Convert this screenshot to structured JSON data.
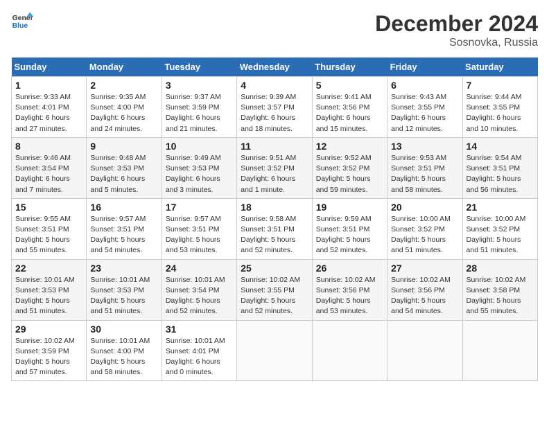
{
  "header": {
    "logo_line1": "General",
    "logo_line2": "Blue",
    "title": "December 2024",
    "subtitle": "Sosnovka, Russia"
  },
  "columns": [
    "Sunday",
    "Monday",
    "Tuesday",
    "Wednesday",
    "Thursday",
    "Friday",
    "Saturday"
  ],
  "weeks": [
    [
      {
        "day": "1",
        "lines": [
          "Sunrise: 9:33 AM",
          "Sunset: 4:01 PM",
          "Daylight: 6 hours",
          "and 27 minutes."
        ]
      },
      {
        "day": "2",
        "lines": [
          "Sunrise: 9:35 AM",
          "Sunset: 4:00 PM",
          "Daylight: 6 hours",
          "and 24 minutes."
        ]
      },
      {
        "day": "3",
        "lines": [
          "Sunrise: 9:37 AM",
          "Sunset: 3:59 PM",
          "Daylight: 6 hours",
          "and 21 minutes."
        ]
      },
      {
        "day": "4",
        "lines": [
          "Sunrise: 9:39 AM",
          "Sunset: 3:57 PM",
          "Daylight: 6 hours",
          "and 18 minutes."
        ]
      },
      {
        "day": "5",
        "lines": [
          "Sunrise: 9:41 AM",
          "Sunset: 3:56 PM",
          "Daylight: 6 hours",
          "and 15 minutes."
        ]
      },
      {
        "day": "6",
        "lines": [
          "Sunrise: 9:43 AM",
          "Sunset: 3:55 PM",
          "Daylight: 6 hours",
          "and 12 minutes."
        ]
      },
      {
        "day": "7",
        "lines": [
          "Sunrise: 9:44 AM",
          "Sunset: 3:55 PM",
          "Daylight: 6 hours",
          "and 10 minutes."
        ]
      }
    ],
    [
      {
        "day": "8",
        "lines": [
          "Sunrise: 9:46 AM",
          "Sunset: 3:54 PM",
          "Daylight: 6 hours",
          "and 7 minutes."
        ]
      },
      {
        "day": "9",
        "lines": [
          "Sunrise: 9:48 AM",
          "Sunset: 3:53 PM",
          "Daylight: 6 hours",
          "and 5 minutes."
        ]
      },
      {
        "day": "10",
        "lines": [
          "Sunrise: 9:49 AM",
          "Sunset: 3:53 PM",
          "Daylight: 6 hours",
          "and 3 minutes."
        ]
      },
      {
        "day": "11",
        "lines": [
          "Sunrise: 9:51 AM",
          "Sunset: 3:52 PM",
          "Daylight: 6 hours",
          "and 1 minute."
        ]
      },
      {
        "day": "12",
        "lines": [
          "Sunrise: 9:52 AM",
          "Sunset: 3:52 PM",
          "Daylight: 5 hours",
          "and 59 minutes."
        ]
      },
      {
        "day": "13",
        "lines": [
          "Sunrise: 9:53 AM",
          "Sunset: 3:51 PM",
          "Daylight: 5 hours",
          "and 58 minutes."
        ]
      },
      {
        "day": "14",
        "lines": [
          "Sunrise: 9:54 AM",
          "Sunset: 3:51 PM",
          "Daylight: 5 hours",
          "and 56 minutes."
        ]
      }
    ],
    [
      {
        "day": "15",
        "lines": [
          "Sunrise: 9:55 AM",
          "Sunset: 3:51 PM",
          "Daylight: 5 hours",
          "and 55 minutes."
        ]
      },
      {
        "day": "16",
        "lines": [
          "Sunrise: 9:57 AM",
          "Sunset: 3:51 PM",
          "Daylight: 5 hours",
          "and 54 minutes."
        ]
      },
      {
        "day": "17",
        "lines": [
          "Sunrise: 9:57 AM",
          "Sunset: 3:51 PM",
          "Daylight: 5 hours",
          "and 53 minutes."
        ]
      },
      {
        "day": "18",
        "lines": [
          "Sunrise: 9:58 AM",
          "Sunset: 3:51 PM",
          "Daylight: 5 hours",
          "and 52 minutes."
        ]
      },
      {
        "day": "19",
        "lines": [
          "Sunrise: 9:59 AM",
          "Sunset: 3:51 PM",
          "Daylight: 5 hours",
          "and 52 minutes."
        ]
      },
      {
        "day": "20",
        "lines": [
          "Sunrise: 10:00 AM",
          "Sunset: 3:52 PM",
          "Daylight: 5 hours",
          "and 51 minutes."
        ]
      },
      {
        "day": "21",
        "lines": [
          "Sunrise: 10:00 AM",
          "Sunset: 3:52 PM",
          "Daylight: 5 hours",
          "and 51 minutes."
        ]
      }
    ],
    [
      {
        "day": "22",
        "lines": [
          "Sunrise: 10:01 AM",
          "Sunset: 3:53 PM",
          "Daylight: 5 hours",
          "and 51 minutes."
        ]
      },
      {
        "day": "23",
        "lines": [
          "Sunrise: 10:01 AM",
          "Sunset: 3:53 PM",
          "Daylight: 5 hours",
          "and 51 minutes."
        ]
      },
      {
        "day": "24",
        "lines": [
          "Sunrise: 10:01 AM",
          "Sunset: 3:54 PM",
          "Daylight: 5 hours",
          "and 52 minutes."
        ]
      },
      {
        "day": "25",
        "lines": [
          "Sunrise: 10:02 AM",
          "Sunset: 3:55 PM",
          "Daylight: 5 hours",
          "and 52 minutes."
        ]
      },
      {
        "day": "26",
        "lines": [
          "Sunrise: 10:02 AM",
          "Sunset: 3:56 PM",
          "Daylight: 5 hours",
          "and 53 minutes."
        ]
      },
      {
        "day": "27",
        "lines": [
          "Sunrise: 10:02 AM",
          "Sunset: 3:56 PM",
          "Daylight: 5 hours",
          "and 54 minutes."
        ]
      },
      {
        "day": "28",
        "lines": [
          "Sunrise: 10:02 AM",
          "Sunset: 3:58 PM",
          "Daylight: 5 hours",
          "and 55 minutes."
        ]
      }
    ],
    [
      {
        "day": "29",
        "lines": [
          "Sunrise: 10:02 AM",
          "Sunset: 3:59 PM",
          "Daylight: 5 hours",
          "and 57 minutes."
        ]
      },
      {
        "day": "30",
        "lines": [
          "Sunrise: 10:01 AM",
          "Sunset: 4:00 PM",
          "Daylight: 5 hours",
          "and 58 minutes."
        ]
      },
      {
        "day": "31",
        "lines": [
          "Sunrise: 10:01 AM",
          "Sunset: 4:01 PM",
          "Daylight: 6 hours",
          "and 0 minutes."
        ]
      },
      null,
      null,
      null,
      null
    ]
  ]
}
